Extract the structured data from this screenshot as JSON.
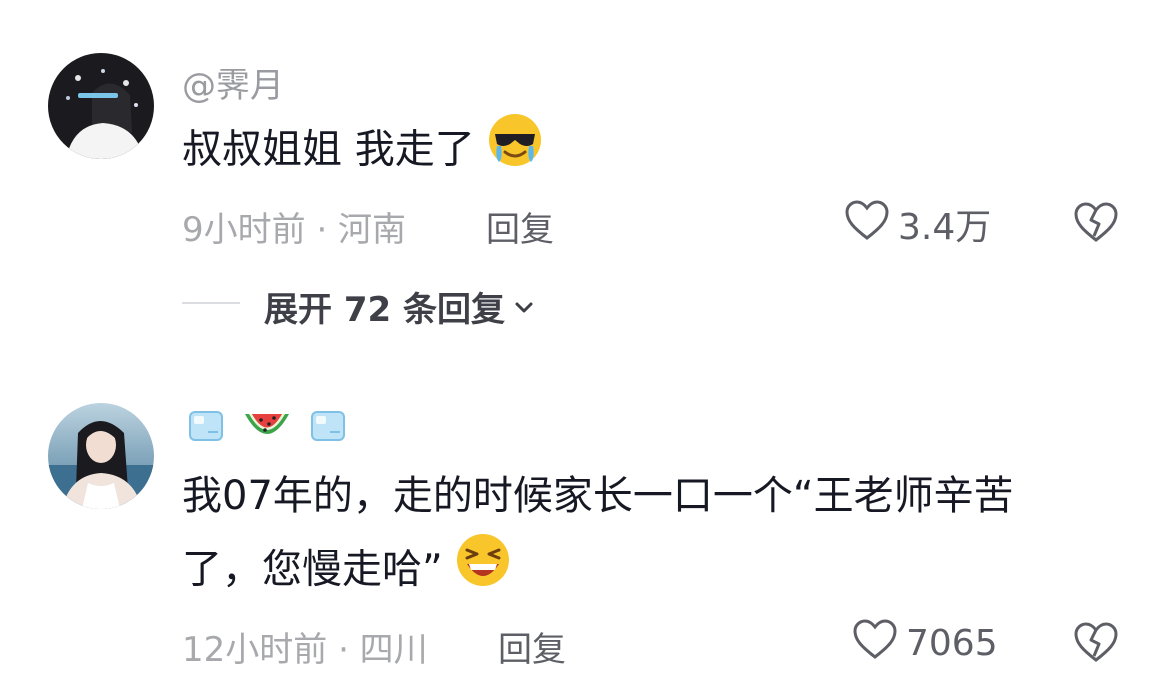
{
  "comments": [
    {
      "username": "@霁月",
      "text": "叔叔姐姐 我走了",
      "emoji": "sunglasses-crying-emoji",
      "time_location": "9小时前 · 河南",
      "reply_label": "回复",
      "likes": "3.4万",
      "expand_label": "展开 72 条回复"
    },
    {
      "username_emojis": [
        "ice-cube-emoji",
        "watermelon-emoji",
        "ice-cube-emoji"
      ],
      "text_line1": "我07年的，走的时候家长一口一个“王老师辛苦",
      "text_line2": "了，您慢走哈”",
      "emoji": "grinning-squint-emoji",
      "time_location": "12小时前 · 四川",
      "reply_label": "回复",
      "likes": "7065"
    }
  ],
  "colors": {
    "text": "#161823",
    "meta": "#a8a9ad",
    "action": "#5e5f66",
    "emoji_yellow": "#f8c52b"
  }
}
